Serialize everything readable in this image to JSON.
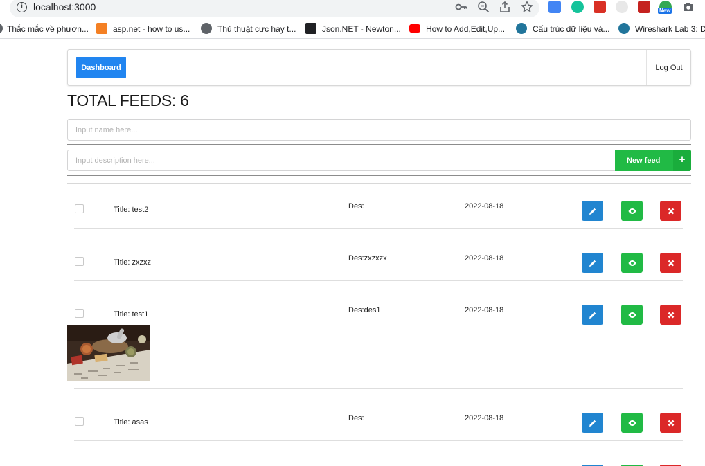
{
  "browser": {
    "url": "localhost:3000",
    "bookmarks": [
      {
        "label": "Thắc mắc về phươn...",
        "icon": "folder-icon"
      },
      {
        "label": "asp.net - how to us...",
        "icon": "stackoverflow-icon"
      },
      {
        "label": "Thủ thuật cực hay t...",
        "icon": "globe-icon"
      },
      {
        "label": "Json.NET - Newton...",
        "icon": "rocket-icon"
      },
      {
        "label": "How to Add,Edit,Up...",
        "icon": "youtube-icon"
      },
      {
        "label": "Cấu trúc dữ liệu và...",
        "icon": "wordpress-icon"
      },
      {
        "label": "Wireshark Lab 3: D...",
        "icon": "wordpress-icon"
      }
    ],
    "extension_badge": "New"
  },
  "nav": {
    "dashboard_label": "Dashboard",
    "logout_label": "Log Out"
  },
  "summary": {
    "total_label": "TOTAL FEEDS: 6"
  },
  "form": {
    "name_placeholder": "Input name here...",
    "description_placeholder": "Input description here...",
    "new_feed_label": "New feed",
    "plus_symbol": "+"
  },
  "feeds": [
    {
      "title": "Title: test2",
      "des": "Des:",
      "date": "2022-08-18",
      "has_image": false
    },
    {
      "title": "Title: zxzxz",
      "des": "Des:zxzxzx",
      "date": "2022-08-18",
      "has_image": false
    },
    {
      "title": "Title: test1",
      "des": "Des:des1",
      "date": "2022-08-18",
      "has_image": true
    },
    {
      "title": "Title: asas",
      "des": "Des:",
      "date": "2022-08-18",
      "has_image": false
    }
  ],
  "colors": {
    "primary": "#2185d0",
    "positive": "#21ba45",
    "negative": "#db2828"
  }
}
